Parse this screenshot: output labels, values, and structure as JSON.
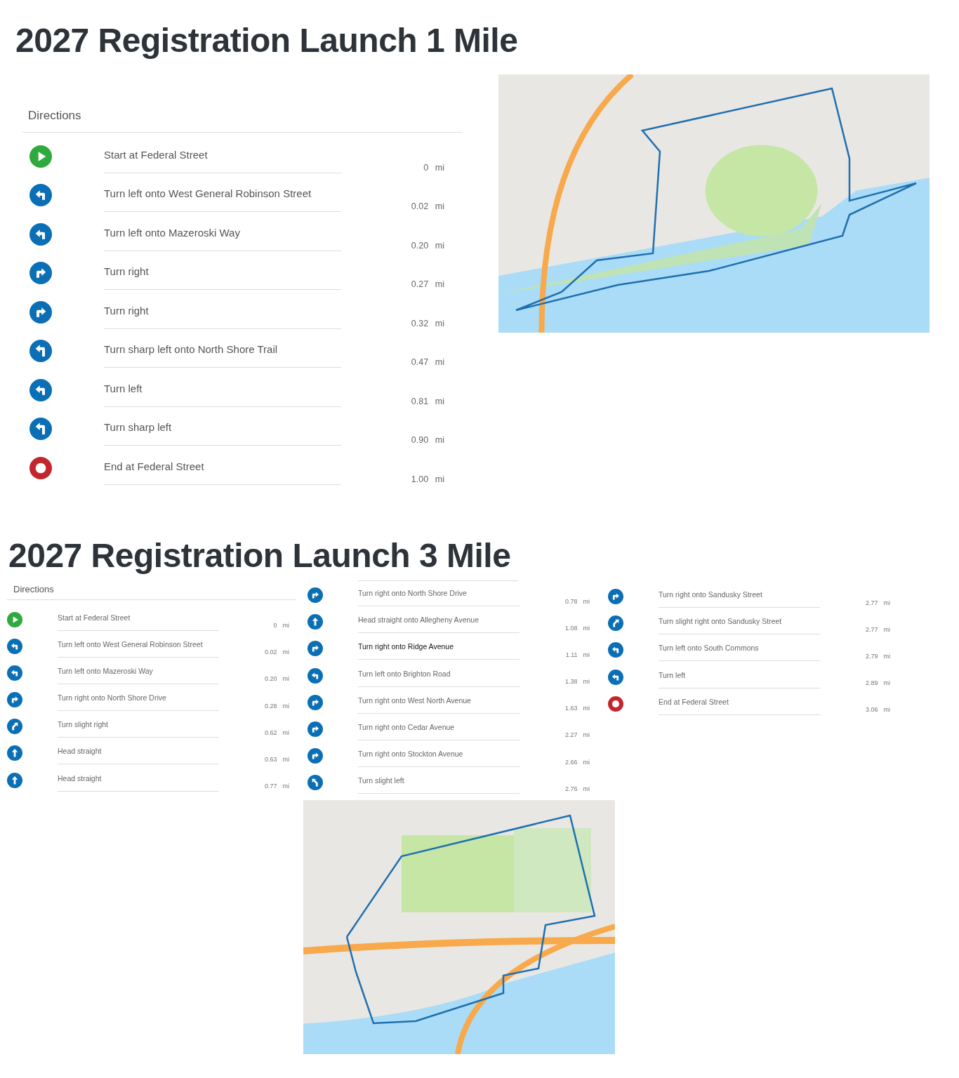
{
  "routes": [
    {
      "kind": "large",
      "title": "2027 Registration Launch 1 Mile",
      "directions_heading": "Directions",
      "columns": [
        [
          {
            "kind": "start",
            "text": "Start at Federal Street",
            "distance": "0 mi"
          },
          {
            "kind": "left",
            "text": "Turn left onto West General Robinson Street",
            "distance": "0.02 mi"
          },
          {
            "kind": "left",
            "text": "Turn left onto Mazeroski Way",
            "distance": "0.20 mi"
          },
          {
            "kind": "right",
            "text": "Turn right",
            "distance": "0.27 mi"
          },
          {
            "kind": "right",
            "text": "Turn right",
            "distance": "0.32 mi"
          },
          {
            "kind": "sharp_left",
            "text": "Turn sharp left onto North Shore Trail",
            "distance": "0.47 mi"
          },
          {
            "kind": "left",
            "text": "Turn left",
            "distance": "0.81 mi"
          },
          {
            "kind": "sharp_left",
            "text": "Turn sharp left",
            "distance": "0.90 mi"
          },
          {
            "kind": "end",
            "text": "End at Federal Street",
            "distance": "1.00 mi"
          }
        ]
      ]
    },
    {
      "kind": "compact",
      "title": "2027 Registration Launch 3 Mile",
      "directions_heading": "Directions",
      "columns": [
        [
          {
            "kind": "start",
            "text": "Start at Federal Street",
            "distance": "0 mi",
            "highlighted": false
          },
          {
            "kind": "left",
            "text": "Turn left onto West General Robinson Street",
            "distance": "0.02 mi",
            "highlighted": false
          },
          {
            "kind": "left",
            "text": "Turn left onto Mazeroski Way",
            "distance": "0.20 mi",
            "highlighted": false
          },
          {
            "kind": "right",
            "text": "Turn right onto North Shore Drive",
            "distance": "0.28 mi",
            "highlighted": false
          },
          {
            "kind": "slight_right",
            "text": "Turn slight right",
            "distance": "0.62 mi",
            "highlighted": false
          },
          {
            "kind": "straight",
            "text": "Head straight",
            "distance": "0.63 mi",
            "highlighted": false
          },
          {
            "kind": "straight",
            "text": "Head straight",
            "distance": "0.77 mi",
            "highlighted": false
          }
        ],
        [
          {
            "kind": "right",
            "text": "Turn right onto North Shore Drive",
            "distance": "0.78 mi",
            "highlighted": false
          },
          {
            "kind": "straight",
            "text": "Head straight onto Allegheny Avenue",
            "distance": "1.08 mi",
            "highlighted": false
          },
          {
            "kind": "right",
            "text": "Turn right onto Ridge Avenue",
            "distance": "1.11 mi",
            "highlighted": true
          },
          {
            "kind": "left",
            "text": "Turn left onto Brighton Road",
            "distance": "1.38 mi",
            "highlighted": false
          },
          {
            "kind": "right",
            "text": "Turn right onto West North Avenue",
            "distance": "1.63 mi",
            "highlighted": false
          },
          {
            "kind": "right",
            "text": "Turn right onto Cedar Avenue",
            "distance": "2.27 mi",
            "highlighted": false
          },
          {
            "kind": "right",
            "text": "Turn right onto Stockton Avenue",
            "distance": "2.66 mi",
            "highlighted": false
          },
          {
            "kind": "slight_left",
            "text": "Turn slight left",
            "distance": "2.76 mi",
            "highlighted": false
          }
        ],
        [
          {
            "kind": "right",
            "text": "Turn right onto Sandusky Street",
            "distance": "2.77 mi",
            "highlighted": false
          },
          {
            "kind": "slight_right",
            "text": "Turn slight right onto Sandusky Street",
            "distance": "2.77 mi",
            "highlighted": false
          },
          {
            "kind": "left",
            "text": "Turn left onto South Commons",
            "distance": "2.79 mi",
            "highlighted": false
          },
          {
            "kind": "left",
            "text": "Turn left",
            "distance": "2.89 mi",
            "highlighted": false
          },
          {
            "kind": "end",
            "text": "End at Federal Street",
            "distance": "3.06 mi",
            "highlighted": false
          }
        ]
      ]
    }
  ]
}
